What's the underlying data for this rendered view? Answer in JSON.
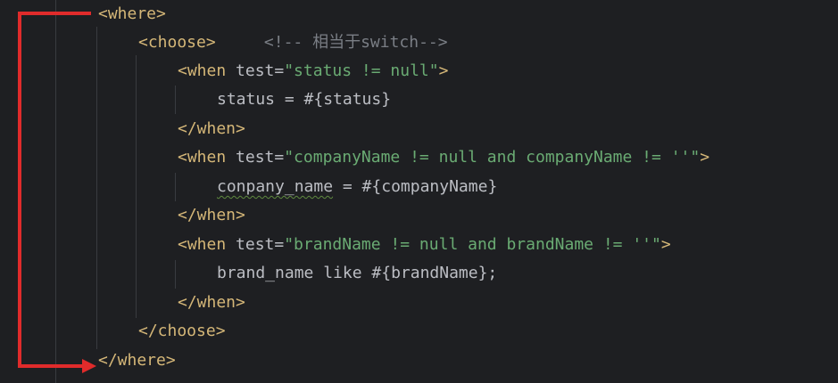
{
  "code": {
    "lines": [
      {
        "tokens": [
          "<where>"
        ]
      },
      {
        "tokens": [
          "<choose>",
          "<!-- 相当于switch-->"
        ]
      },
      {
        "tokens": [
          "<when",
          " test=",
          "\"status != null\"",
          ">"
        ]
      },
      {
        "tokens": [
          "status = #{status}"
        ]
      },
      {
        "tokens": [
          "</when>"
        ]
      },
      {
        "tokens": [
          "<when",
          " test=",
          "\"companyName != null and companyName != ''\"",
          ">"
        ]
      },
      {
        "tokens": [
          "conpany_name",
          " = #{companyName}"
        ]
      },
      {
        "tokens": [
          "</when>"
        ]
      },
      {
        "tokens": [
          "<when",
          " test=",
          "\"brandName != null and brandName != ''\"",
          ">"
        ]
      },
      {
        "tokens": [
          "brand_name like #{brandName};"
        ]
      },
      {
        "tokens": [
          "</when>"
        ]
      },
      {
        "tokens": [
          "</choose>"
        ]
      },
      {
        "tokens": [
          "</where>"
        ]
      }
    ]
  },
  "colors": {
    "background": "#1e1f22",
    "tag": "#d5b778",
    "attribute": "#bcbec4",
    "string": "#6aab73",
    "comment": "#7a7e85",
    "annotation_arrow": "#e02b2b"
  },
  "annotation": {
    "arrow": "red bracket arrow from <where> to </where>"
  }
}
